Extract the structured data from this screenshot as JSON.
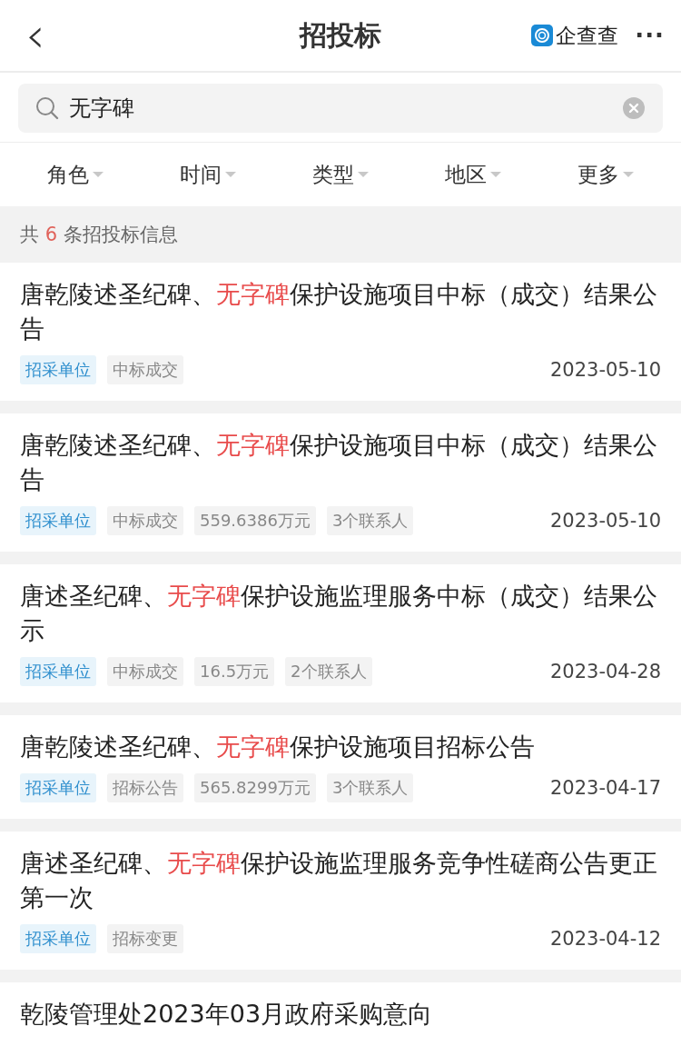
{
  "header": {
    "back": "‹",
    "title": "招投标",
    "brand": "企查查",
    "more": "···"
  },
  "search": {
    "value": "无字碑"
  },
  "filters": [
    {
      "label": "角色"
    },
    {
      "label": "时间"
    },
    {
      "label": "类型"
    },
    {
      "label": "地区"
    },
    {
      "label": "更多"
    }
  ],
  "summary": {
    "prefix": "共",
    "count": "6",
    "suffix": "条招投标信息"
  },
  "results": [
    {
      "title": {
        "before": "唐乾陵述圣纪碑、",
        "highlight": "无字碑",
        "after": "保护设施项目中标（成交）结果公告"
      },
      "tags": [
        {
          "kind": "role",
          "text": "招采单位"
        },
        {
          "kind": "plain",
          "text": "中标成交"
        }
      ],
      "date": "2023-05-10"
    },
    {
      "title": {
        "before": "唐乾陵述圣纪碑、",
        "highlight": "无字碑",
        "after": "保护设施项目中标（成交）结果公告"
      },
      "tags": [
        {
          "kind": "role",
          "text": "招采单位"
        },
        {
          "kind": "plain",
          "text": "中标成交"
        },
        {
          "kind": "plain",
          "text": "559.6386万元"
        },
        {
          "kind": "plain",
          "text": "3个联系人"
        }
      ],
      "date": "2023-05-10"
    },
    {
      "title": {
        "before": "唐述圣纪碑、",
        "highlight": "无字碑",
        "after": "保护设施监理服务中标（成交）结果公示"
      },
      "tags": [
        {
          "kind": "role",
          "text": "招采单位"
        },
        {
          "kind": "plain",
          "text": "中标成交"
        },
        {
          "kind": "plain",
          "text": "16.5万元"
        },
        {
          "kind": "plain",
          "text": "2个联系人"
        }
      ],
      "date": "2023-04-28"
    },
    {
      "title": {
        "before": "唐乾陵述圣纪碑、",
        "highlight": "无字碑",
        "after": "保护设施项目招标公告"
      },
      "tags": [
        {
          "kind": "role",
          "text": "招采单位"
        },
        {
          "kind": "plain",
          "text": "招标公告"
        },
        {
          "kind": "plain",
          "text": "565.8299万元"
        },
        {
          "kind": "plain",
          "text": "3个联系人"
        }
      ],
      "date": "2023-04-17"
    },
    {
      "title": {
        "before": "唐述圣纪碑、",
        "highlight": "无字碑",
        "after": "保护设施监理服务竞争性磋商公告更正第一次"
      },
      "tags": [
        {
          "kind": "role",
          "text": "招采单位"
        },
        {
          "kind": "plain",
          "text": "招标变更"
        }
      ],
      "date": "2023-04-12"
    },
    {
      "title": {
        "before": "乾陵管理处2023年03月政府采购意向"
      }
    }
  ]
}
